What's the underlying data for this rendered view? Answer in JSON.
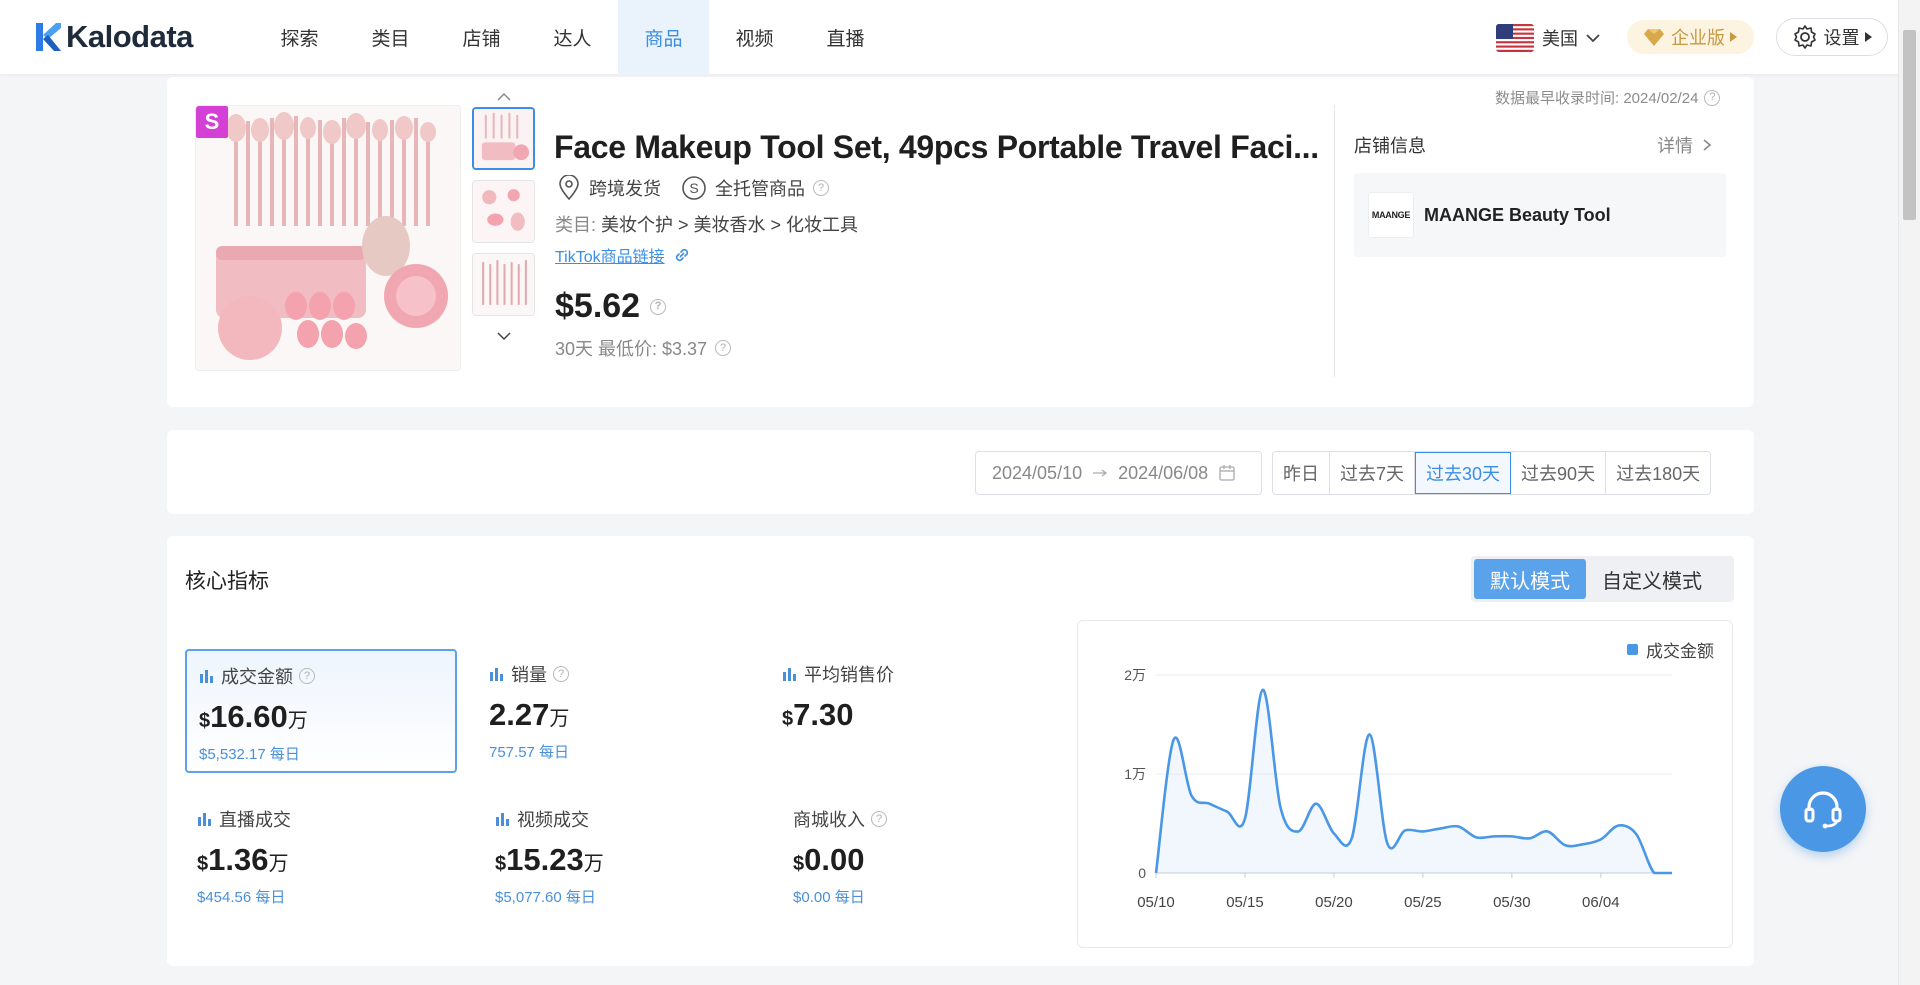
{
  "brand": "Kalodata",
  "nav": [
    "探索",
    "类目",
    "店铺",
    "达人",
    "商品",
    "视频",
    "直播"
  ],
  "nav_active": "商品",
  "header": {
    "region": "美国",
    "enterprise": "企业版",
    "settings": "设置"
  },
  "product": {
    "earliest": "数据最早收录时间: 2024/02/24",
    "badge": "S",
    "title": "Face Makeup Tool Set, 49pcs Portable Travel Faci...",
    "tag_ship": "跨境发货",
    "tag_managed": "全托管商品",
    "category_label": "类目:",
    "category": "美妆个护 > 美妆香水 > 化妆工具",
    "tiktok_link": "TikTok商品链接",
    "price": "$5.62",
    "low_price": "30天 最低价: $3.37"
  },
  "store": {
    "title": "店铺信息",
    "more": "详情",
    "logo_text": "MAANGE",
    "name": "MAANGE Beauty Tool"
  },
  "date_filter": {
    "start": "2024/05/10",
    "end": "2024/06/08",
    "options": [
      "昨日",
      "过去7天",
      "过去30天",
      "过去90天",
      "过去180天"
    ],
    "active": "过去30天"
  },
  "core": {
    "title": "核心指标",
    "modes": [
      "默认模式",
      "自定义模式"
    ],
    "active_mode": "默认模式",
    "metrics": [
      {
        "label": "成交金额",
        "cur": "$",
        "value": "16.60",
        "unit": "万",
        "daily": "$5,532.17 每日"
      },
      {
        "label": "销量",
        "cur": "",
        "value": "2.27",
        "unit": "万",
        "daily": "757.57 每日"
      },
      {
        "label": "平均销售价",
        "cur": "$",
        "value": "7.30",
        "unit": "",
        "daily": ""
      },
      {
        "label": "直播成交",
        "cur": "$",
        "value": "1.36",
        "unit": "万",
        "daily": "$454.56 每日"
      },
      {
        "label": "视频成交",
        "cur": "$",
        "value": "15.23",
        "unit": "万",
        "daily": "$5,077.60 每日"
      },
      {
        "label": "商城收入",
        "cur": "$",
        "value": "0.00",
        "unit": "",
        "daily": "$0.00 每日"
      }
    ]
  },
  "colors": {
    "accent": "#3a8ee6",
    "line": "#4a97e6",
    "gold": "#c69a44",
    "badge": "#d43fd6"
  },
  "chart_data": {
    "type": "area",
    "legend": "成交金额",
    "yticks": [
      "0",
      "1万",
      "2万"
    ],
    "ylim": [
      0,
      20000
    ],
    "xticks": [
      "05/10",
      "05/15",
      "05/20",
      "05/25",
      "05/30",
      "06/04"
    ],
    "x": [
      "05/10",
      "05/11",
      "05/12",
      "05/13",
      "05/14",
      "05/15",
      "05/16",
      "05/17",
      "05/18",
      "05/19",
      "05/20",
      "05/21",
      "05/22",
      "05/23",
      "05/24",
      "05/25",
      "05/26",
      "05/27",
      "05/28",
      "05/29",
      "05/30",
      "05/31",
      "06/01",
      "06/02",
      "06/03",
      "06/04",
      "06/05",
      "06/06",
      "06/07",
      "06/08"
    ],
    "values": [
      0,
      13500,
      7800,
      7000,
      6200,
      5500,
      18500,
      6600,
      4200,
      7000,
      4000,
      3500,
      14000,
      3000,
      4300,
      4200,
      4500,
      4700,
      3600,
      3700,
      3700,
      3500,
      4200,
      2800,
      2900,
      3400,
      4800,
      3900,
      0,
      0
    ],
    "series": [
      {
        "name": "成交金额"
      }
    ],
    "legend_position": "top-right",
    "grid": true
  }
}
